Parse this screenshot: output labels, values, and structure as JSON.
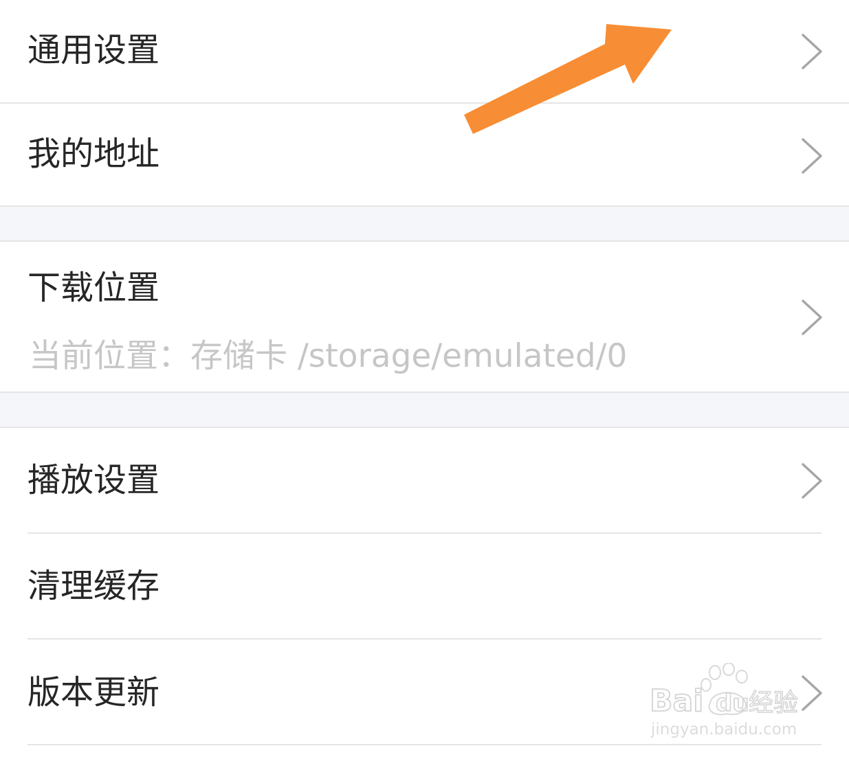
{
  "settings": {
    "items": [
      {
        "label": "通用设置"
      },
      {
        "label": "我的地址"
      },
      {
        "label": "下载位置",
        "sub": "当前位置：存储卡 /storage/emulated/0"
      },
      {
        "label": "播放设置"
      },
      {
        "label": "清理缓存"
      },
      {
        "label": "版本更新"
      }
    ]
  },
  "icons": {
    "chevron": "chevron-right-icon",
    "annotation": "annotation-arrow-icon",
    "watermark": "baidu-jingyan-watermark"
  },
  "watermark": {
    "brand": "Bai du 经验",
    "url": "jingyan.baidu.com"
  },
  "colors": {
    "arrow": "#f78d34",
    "divider": "#e5e5e5",
    "section_gap": "#f5f6f9",
    "label": "#262626",
    "sublabel": "#c6c6c6",
    "chevron": "#a6a6a6"
  }
}
